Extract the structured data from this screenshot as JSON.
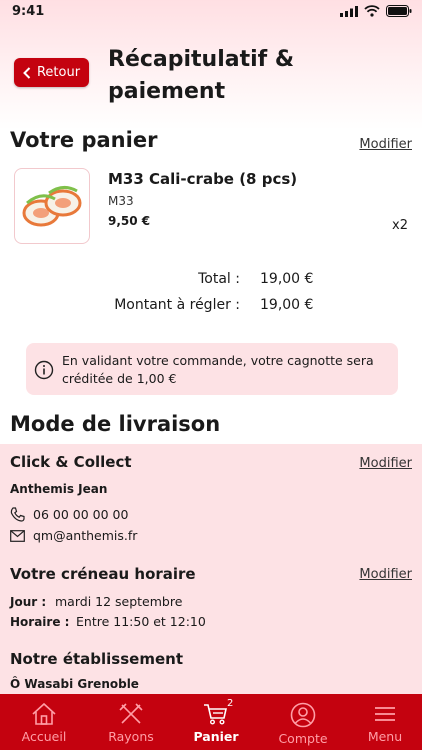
{
  "status": {
    "time": "9:41"
  },
  "header": {
    "back_label": "Retour",
    "title": "Récapitulatif & paiement"
  },
  "cart": {
    "section_title": "Votre panier",
    "edit_label": "Modifier",
    "item": {
      "name": "M33 Cali-crabe (8 pcs)",
      "code": "M33",
      "price": "9,50 €",
      "qty": "x2"
    },
    "total_label": "Total :",
    "total_value": "19,00 €",
    "due_label": "Montant à régler :",
    "due_value": "19,00 €"
  },
  "notice": {
    "text": "En validant votre commande, votre cagnotte sera créditée de 1,00 €"
  },
  "delivery": {
    "section_title": "Mode de livraison",
    "mode": "Click & Collect",
    "edit_label": "Modifier",
    "customer": "Anthemis Jean",
    "phone": "06 00 00 00 00",
    "email": "qm@anthemis.fr",
    "slot_title": "Votre créneau horaire",
    "slot_edit_label": "Modifier",
    "day_label": "Jour :",
    "day_value": "mardi 12 septembre",
    "time_label": "Horaire :",
    "time_value": "Entre 11:50 et 12:10",
    "shop_title": "Notre établissement",
    "shop_name": "Ô Wasabi Grenoble"
  },
  "tabbar": {
    "items": [
      {
        "label": "Accueil",
        "icon": "home-icon"
      },
      {
        "label": "Rayons",
        "icon": "cutlery-icon"
      },
      {
        "label": "Panier",
        "icon": "cart-icon",
        "badge": "2",
        "active": true
      },
      {
        "label": "Compte",
        "icon": "account-icon"
      },
      {
        "label": "Menu",
        "icon": "menu-icon"
      }
    ]
  },
  "colors": {
    "accent": "#c4020f",
    "pink_bg": "#fde2e5",
    "inactive_tab": "#ff9ea6"
  }
}
